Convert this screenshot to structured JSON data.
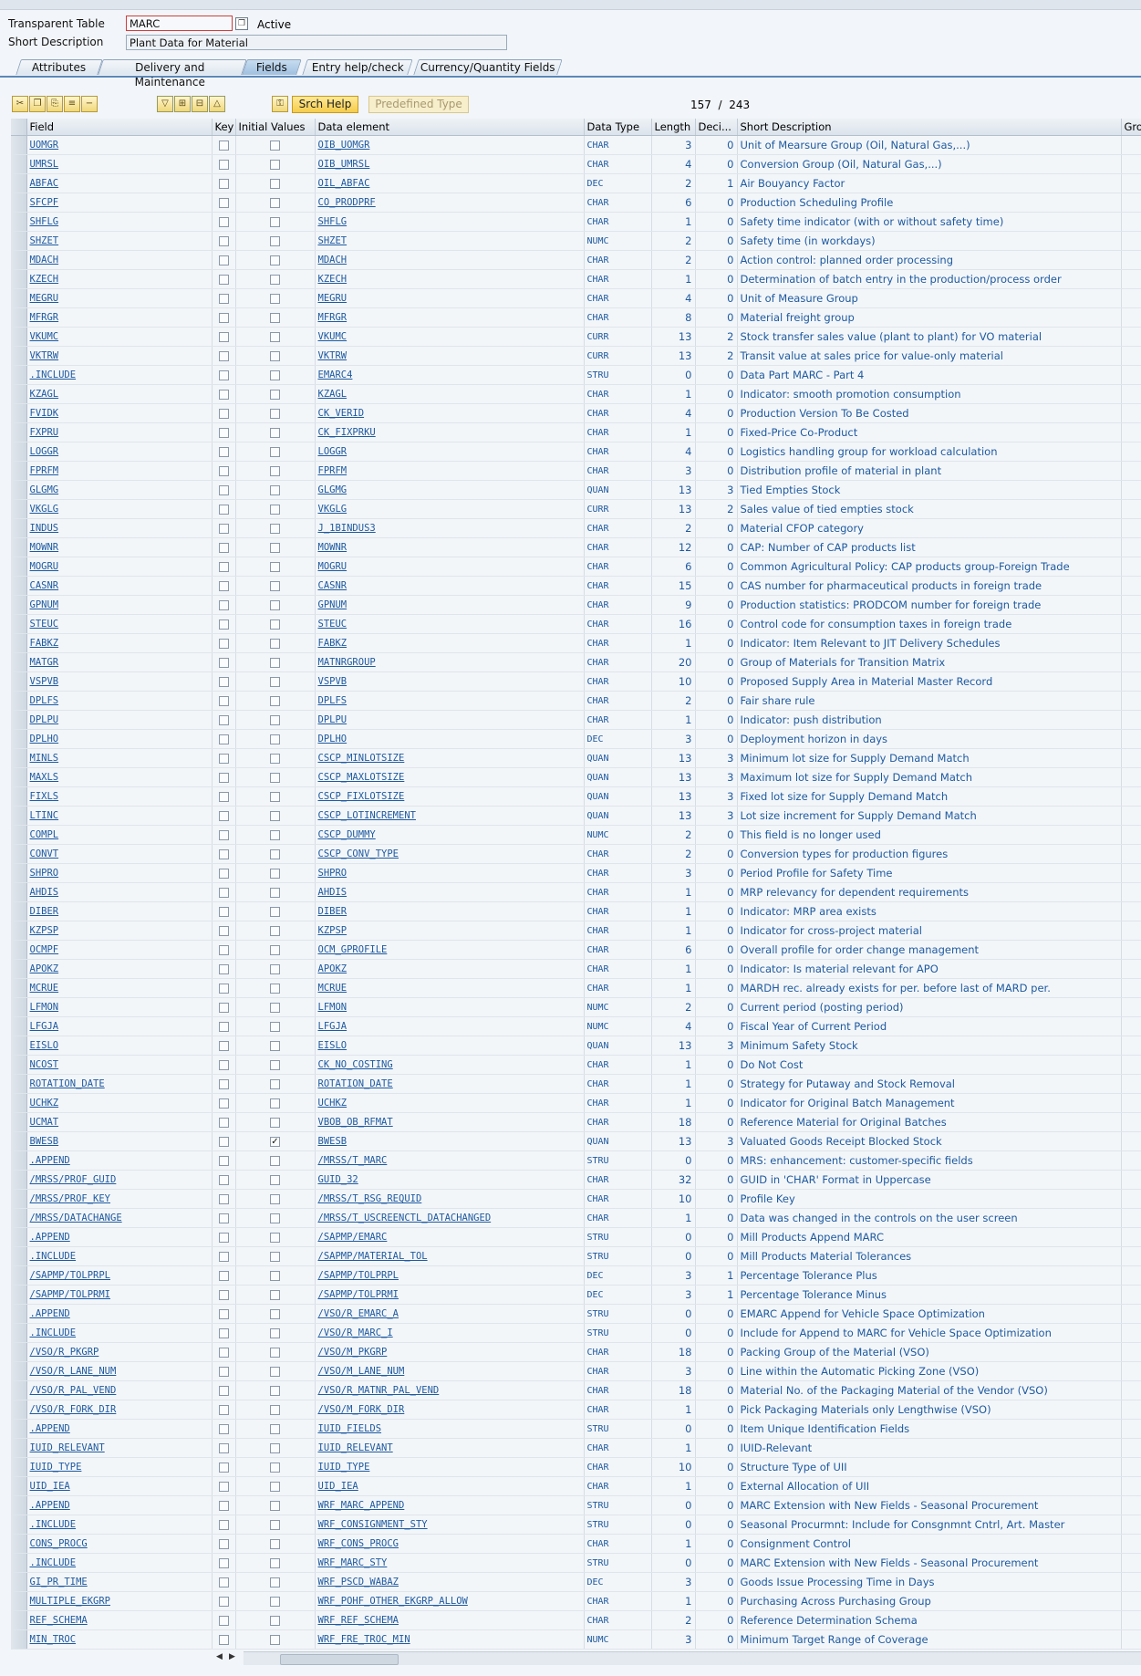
{
  "header": {
    "table_label": "Transparent Table",
    "table_value": "MARC",
    "status": "Active",
    "desc_label": "Short Description",
    "desc_value": "Plant Data for Material"
  },
  "tabs": [
    "Attributes",
    "Delivery and Maintenance",
    "Fields",
    "Entry help/check",
    "Currency/Quantity Fields"
  ],
  "selected_tab": "Fields",
  "toolbar": {
    "srch_help": "Srch Help",
    "predefined_type": "Predefined Type",
    "current": "157",
    "total": "243",
    "sep": "/"
  },
  "columns": [
    "Field",
    "Key",
    "Initial Values",
    "Data element",
    "Data Type",
    "Length",
    "Deci...",
    "Short Description",
    "Gro"
  ],
  "rows": [
    [
      "UOMGR",
      "OIB_UOMGR",
      "CHAR",
      "3",
      "0",
      "Unit of Mearsure Group (Oil, Natural Gas,...)",
      0
    ],
    [
      "UMRSL",
      "OIB_UMRSL",
      "CHAR",
      "4",
      "0",
      "Conversion Group (Oil, Natural Gas,...)",
      0
    ],
    [
      "ABFAC",
      "OIL_ABFAC",
      "DEC",
      "2",
      "1",
      "Air Bouyancy Factor",
      0
    ],
    [
      "SFCPF",
      "CO_PRODPRF",
      "CHAR",
      "6",
      "0",
      "Production Scheduling Profile",
      0
    ],
    [
      "SHFLG",
      "SHFLG",
      "CHAR",
      "1",
      "0",
      "Safety time indicator (with or without safety time)",
      0
    ],
    [
      "SHZET",
      "SHZET",
      "NUMC",
      "2",
      "0",
      "Safety time (in workdays)",
      0
    ],
    [
      "MDACH",
      "MDACH",
      "CHAR",
      "2",
      "0",
      "Action control: planned order processing",
      0
    ],
    [
      "KZECH",
      "KZECH",
      "CHAR",
      "1",
      "0",
      "Determination of batch entry in the production/process order",
      0
    ],
    [
      "MEGRU",
      "MEGRU",
      "CHAR",
      "4",
      "0",
      "Unit of Measure Group",
      0
    ],
    [
      "MFRGR",
      "MFRGR",
      "CHAR",
      "8",
      "0",
      "Material freight group",
      0
    ],
    [
      "VKUMC",
      "VKUMC",
      "CURR",
      "13",
      "2",
      "Stock transfer sales value (plant to plant) for VO material",
      0
    ],
    [
      "VKTRW",
      "VKTRW",
      "CURR",
      "13",
      "2",
      "Transit value at sales price for value-only material",
      0
    ],
    [
      ".INCLUDE",
      "EMARC4",
      "STRU",
      "0",
      "0",
      "Data Part MARC - Part 4",
      0
    ],
    [
      "KZAGL",
      "KZAGL",
      "CHAR",
      "1",
      "0",
      "Indicator: smooth promotion consumption",
      0
    ],
    [
      "FVIDK",
      "CK_VERID",
      "CHAR",
      "4",
      "0",
      "Production Version To Be Costed",
      0
    ],
    [
      "FXPRU",
      "CK_FIXPRKU",
      "CHAR",
      "1",
      "0",
      "Fixed-Price Co-Product",
      0
    ],
    [
      "LOGGR",
      "LOGGR",
      "CHAR",
      "4",
      "0",
      "Logistics handling group for workload calculation",
      0
    ],
    [
      "FPRFM",
      "FPRFM",
      "CHAR",
      "3",
      "0",
      "Distribution profile of material in plant",
      0
    ],
    [
      "GLGMG",
      "GLGMG",
      "QUAN",
      "13",
      "3",
      "Tied Empties Stock",
      0
    ],
    [
      "VKGLG",
      "VKGLG",
      "CURR",
      "13",
      "2",
      "Sales value of tied empties stock",
      0
    ],
    [
      "INDUS",
      "J_1BINDUS3",
      "CHAR",
      "2",
      "0",
      "Material CFOP category",
      0
    ],
    [
      "MOWNR",
      "MOWNR",
      "CHAR",
      "12",
      "0",
      "CAP: Number of CAP products list",
      0
    ],
    [
      "MOGRU",
      "MOGRU",
      "CHAR",
      "6",
      "0",
      "Common Agricultural Policy: CAP products group-Foreign Trade",
      0
    ],
    [
      "CASNR",
      "CASNR",
      "CHAR",
      "15",
      "0",
      "CAS number for pharmaceutical products in foreign trade",
      0
    ],
    [
      "GPNUM",
      "GPNUM",
      "CHAR",
      "9",
      "0",
      "Production statistics: PRODCOM number for foreign trade",
      0
    ],
    [
      "STEUC",
      "STEUC",
      "CHAR",
      "16",
      "0",
      "Control code for consumption taxes in foreign trade",
      0
    ],
    [
      "FABKZ",
      "FABKZ",
      "CHAR",
      "1",
      "0",
      "Indicator: Item Relevant to JIT Delivery Schedules",
      0
    ],
    [
      "MATGR",
      "MATNRGROUP",
      "CHAR",
      "20",
      "0",
      "Group of Materials for Transition Matrix",
      0
    ],
    [
      "VSPVB",
      "VSPVB",
      "CHAR",
      "10",
      "0",
      "Proposed Supply Area in Material Master Record",
      0
    ],
    [
      "DPLFS",
      "DPLFS",
      "CHAR",
      "2",
      "0",
      "Fair share rule",
      0
    ],
    [
      "DPLPU",
      "DPLPU",
      "CHAR",
      "1",
      "0",
      "Indicator: push distribution",
      0
    ],
    [
      "DPLHO",
      "DPLHO",
      "DEC",
      "3",
      "0",
      "Deployment horizon in days",
      0
    ],
    [
      "MINLS",
      "CSCP_MINLOTSIZE",
      "QUAN",
      "13",
      "3",
      "Minimum lot size for Supply Demand Match",
      0
    ],
    [
      "MAXLS",
      "CSCP_MAXLOTSIZE",
      "QUAN",
      "13",
      "3",
      "Maximum lot size for Supply Demand Match",
      0
    ],
    [
      "FIXLS",
      "CSCP_FIXLOTSIZE",
      "QUAN",
      "13",
      "3",
      "Fixed lot size for Supply Demand Match",
      0
    ],
    [
      "LTINC",
      "CSCP_LOTINCREMENT",
      "QUAN",
      "13",
      "3",
      "Lot size increment for  Supply Demand Match",
      0
    ],
    [
      "COMPL",
      "CSCP_DUMMY",
      "NUMC",
      "2",
      "0",
      "This field is no longer used",
      0
    ],
    [
      "CONVT",
      "CSCP_CONV_TYPE",
      "CHAR",
      "2",
      "0",
      "Conversion types for production figures",
      0
    ],
    [
      "SHPRO",
      "SHPRO",
      "CHAR",
      "3",
      "0",
      "Period Profile for Safety Time",
      0
    ],
    [
      "AHDIS",
      "AHDIS",
      "CHAR",
      "1",
      "0",
      "MRP relevancy for dependent requirements",
      0
    ],
    [
      "DIBER",
      "DIBER",
      "CHAR",
      "1",
      "0",
      "Indicator: MRP area exists",
      0
    ],
    [
      "KZPSP",
      "KZPSP",
      "CHAR",
      "1",
      "0",
      "Indicator for cross-project material",
      0
    ],
    [
      "OCMPF",
      "OCM_GPROFILE",
      "CHAR",
      "6",
      "0",
      "Overall profile for order change management",
      0
    ],
    [
      "APOKZ",
      "APOKZ",
      "CHAR",
      "1",
      "0",
      "Indicator: Is material relevant for APO",
      0
    ],
    [
      "MCRUE",
      "MCRUE",
      "CHAR",
      "1",
      "0",
      "MARDH rec. already exists for per. before last of MARD per.",
      0
    ],
    [
      "LFMON",
      "LFMON",
      "NUMC",
      "2",
      "0",
      "Current period (posting period)",
      0
    ],
    [
      "LFGJA",
      "LFGJA",
      "NUMC",
      "4",
      "0",
      "Fiscal Year of Current Period",
      0
    ],
    [
      "EISLO",
      "EISLO",
      "QUAN",
      "13",
      "3",
      "Minimum Safety Stock",
      0
    ],
    [
      "NCOST",
      "CK_NO_COSTING",
      "CHAR",
      "1",
      "0",
      "Do Not Cost",
      0
    ],
    [
      "ROTATION_DATE",
      "ROTATION_DATE",
      "CHAR",
      "1",
      "0",
      "Strategy for Putaway and Stock Removal",
      0
    ],
    [
      "UCHKZ",
      "UCHKZ",
      "CHAR",
      "1",
      "0",
      "Indicator for Original Batch Management",
      0
    ],
    [
      "UCMAT",
      "VBOB_OB_RFMAT",
      "CHAR",
      "18",
      "0",
      "Reference Material for Original Batches",
      0
    ],
    [
      "BWESB",
      "BWESB",
      "QUAN",
      "13",
      "3",
      "Valuated Goods Receipt Blocked Stock",
      1
    ],
    [
      ".APPEND",
      "/MRSS/T_MARC",
      "STRU",
      "0",
      "0",
      "MRS: enhancement: customer-specific fields",
      0
    ],
    [
      "/MRSS/PROF_GUID",
      "GUID_32",
      "CHAR",
      "32",
      "0",
      "GUID in 'CHAR' Format in Uppercase",
      0
    ],
    [
      "/MRSS/PROF_KEY",
      "/MRSS/T_RSG_REQUID",
      "CHAR",
      "10",
      "0",
      "Profile Key",
      0
    ],
    [
      "/MRSS/DATACHANGE",
      "/MRSS/T_USCREENCTL_DATACHANGED",
      "CHAR",
      "1",
      "0",
      "Data was changed in the controls on the user screen",
      0
    ],
    [
      ".APPEND",
      "/SAPMP/EMARC",
      "STRU",
      "0",
      "0",
      "Mill Products Append MARC",
      0
    ],
    [
      ".INCLUDE",
      "/SAPMP/MATERIAL_TOL",
      "STRU",
      "0",
      "0",
      "Mill Products Material Tolerances",
      0
    ],
    [
      "/SAPMP/TOLPRPL",
      "/SAPMP/TOLPRPL",
      "DEC",
      "3",
      "1",
      "Percentage Tolerance Plus",
      0
    ],
    [
      "/SAPMP/TOLPRMI",
      "/SAPMP/TOLPRMI",
      "DEC",
      "3",
      "1",
      "Percentage Tolerance Minus",
      0
    ],
    [
      ".APPEND",
      "/VSO/R_EMARC_A",
      "STRU",
      "0",
      "0",
      "EMARC Append for Vehicle Space Optimization",
      0
    ],
    [
      ".INCLUDE",
      "/VSO/R_MARC_I",
      "STRU",
      "0",
      "0",
      "Include for Append to MARC for Vehicle Space Optimization",
      0
    ],
    [
      "/VSO/R_PKGRP",
      "/VSO/M_PKGRP",
      "CHAR",
      "18",
      "0",
      "Packing Group of the Material (VSO)",
      0
    ],
    [
      "/VSO/R_LANE_NUM",
      "/VSO/M_LANE_NUM",
      "CHAR",
      "3",
      "0",
      "Line within the Automatic Picking Zone (VSO)",
      0
    ],
    [
      "/VSO/R_PAL_VEND",
      "/VSO/R_MATNR_PAL_VEND",
      "CHAR",
      "18",
      "0",
      "Material No. of the Packaging Material of the Vendor (VSO)",
      0
    ],
    [
      "/VSO/R_FORK_DIR",
      "/VSO/M_FORK_DIR",
      "CHAR",
      "1",
      "0",
      "Pick Packaging Materials only Lengthwise (VSO)",
      0
    ],
    [
      ".APPEND",
      "IUID_FIELDS",
      "STRU",
      "0",
      "0",
      "Item Unique Identification Fields",
      0
    ],
    [
      "IUID_RELEVANT",
      "IUID_RELEVANT",
      "CHAR",
      "1",
      "0",
      "IUID-Relevant",
      0
    ],
    [
      "IUID_TYPE",
      "IUID_TYPE",
      "CHAR",
      "10",
      "0",
      "Structure Type of UII",
      0
    ],
    [
      "UID_IEA",
      "UID_IEA",
      "CHAR",
      "1",
      "0",
      "External Allocation of UII",
      0
    ],
    [
      ".APPEND",
      "WRF_MARC_APPEND",
      "STRU",
      "0",
      "0",
      "MARC Extension with New Fields - Seasonal Procurement",
      0
    ],
    [
      ".INCLUDE",
      "WRF_CONSIGNMENT_STY",
      "STRU",
      "0",
      "0",
      "Seasonal Procurmnt: Include for Consgnmnt Cntrl, Art. Master",
      0
    ],
    [
      "CONS_PROCG",
      "WRF_CONS_PROCG",
      "CHAR",
      "1",
      "0",
      "Consignment Control",
      0
    ],
    [
      ".INCLUDE",
      "WRF_MARC_STY",
      "STRU",
      "0",
      "0",
      "MARC Extension with New Fields - Seasonal Procurement",
      0
    ],
    [
      "GI_PR_TIME",
      "WRF_PSCD_WABAZ",
      "DEC",
      "3",
      "0",
      "Goods Issue Processing Time in Days",
      0
    ],
    [
      "MULTIPLE_EKGRP",
      "WRF_POHF_OTHER_EKGRP_ALLOW",
      "CHAR",
      "1",
      "0",
      "Purchasing Across Purchasing Group",
      0
    ],
    [
      "REF_SCHEMA",
      "WRF_REF_SCHEMA",
      "CHAR",
      "2",
      "0",
      "Reference Determination Schema",
      0
    ],
    [
      "MIN_TROC",
      "WRF_FRE_TROC_MIN",
      "NUMC",
      "3",
      "0",
      "Minimum Target Range of Coverage",
      0
    ]
  ],
  "colors": {
    "link": "#1e5aa0",
    "tab_selected": "#9fc0e0",
    "srch_button": "#f5cc4a"
  }
}
